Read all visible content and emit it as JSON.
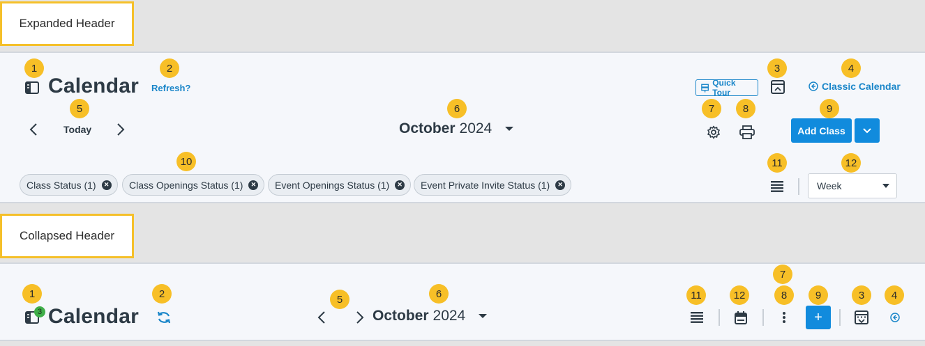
{
  "expanded": {
    "section_label": "Expanded Header",
    "title": "Calendar",
    "refresh_label": "Refresh?",
    "quick_tour_label": "Quick Tour",
    "classic_calendar_label": "Classic Calendar",
    "today_label": "Today",
    "month": "October",
    "year": "2024",
    "add_class_label": "Add Class",
    "filters": [
      "Class Status (1)",
      "Class Openings Status (1)",
      "Event Openings Status (1)",
      "Event Private Invite Status (1)"
    ],
    "view_select_value": "Week",
    "badges": [
      "1",
      "2",
      "3",
      "4",
      "5",
      "6",
      "7",
      "8",
      "9",
      "10",
      "11",
      "12"
    ]
  },
  "collapsed": {
    "section_label": "Collapsed Header",
    "title": "Calendar",
    "notification_count": "3",
    "month": "October",
    "year": "2024",
    "add_label": "+",
    "badges": [
      "1",
      "2",
      "5",
      "6",
      "11",
      "12",
      "7",
      "8",
      "9",
      "3",
      "4"
    ]
  },
  "colors": {
    "accent": "#118bdd",
    "badge": "#f7bf27",
    "link": "#1a86c9",
    "notification": "#3fae49"
  }
}
